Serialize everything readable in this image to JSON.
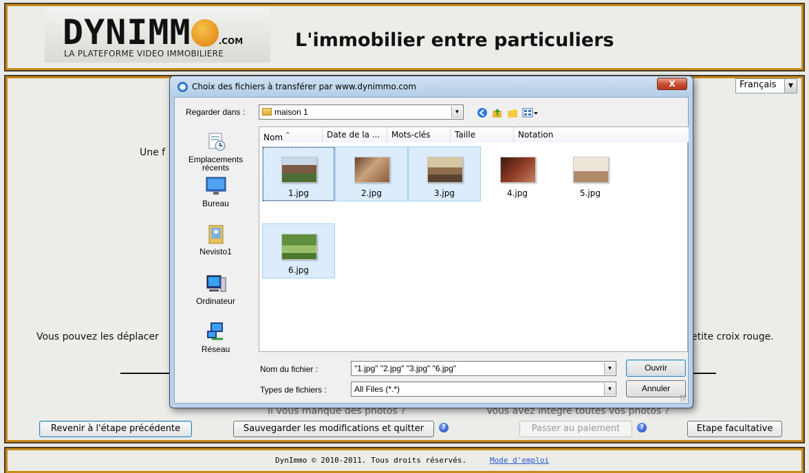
{
  "header": {
    "logo_word_part1": "DYNIMM",
    "logo_com": ".COM",
    "logo_subtitle": "LA PLATEFORME VIDEO IMMOBILIERE",
    "tagline": "L'immobilier entre particuliers"
  },
  "language": {
    "selected": "Français"
  },
  "main": {
    "partial_text_left": "Une f",
    "hint_left": "Vous pouvez les déplacer",
    "hint_right": "etite croix rouge.",
    "missing_photos": "Il vous manque des photos ?",
    "all_photos": "Vous avez intégré toutes vos photos ?",
    "buttons": {
      "previous": "Revenir à l'étape précédente",
      "save_quit": "Sauvegarder les modifications et quitter",
      "pay": "Passer au paiement",
      "optional": "Etape facultative"
    }
  },
  "footer": {
    "copyright": "DynImmo © 2010-2011. Tous droits réservés.",
    "manual_link": "Mode d'emploi"
  },
  "dialog": {
    "title": "Choix des fichiers à transférer par www.dynimmo.com",
    "close": "X",
    "look_in_label": "Regarder dans :",
    "look_in_value": "maison 1",
    "places": [
      {
        "label": "Emplacements récents",
        "icon": "recent-places-icon"
      },
      {
        "label": "Bureau",
        "icon": "desktop-icon"
      },
      {
        "label": "Nevisto1",
        "icon": "user-folder-icon"
      },
      {
        "label": "Ordinateur",
        "icon": "computer-icon"
      },
      {
        "label": "Réseau",
        "icon": "network-icon"
      }
    ],
    "columns": [
      "Nom",
      "Date de la ...",
      "Mots-clés",
      "Taille",
      "Notation"
    ],
    "files": [
      {
        "name": "1.jpg",
        "selected": true
      },
      {
        "name": "2.jpg",
        "selected": true
      },
      {
        "name": "3.jpg",
        "selected": true
      },
      {
        "name": "4.jpg",
        "selected": false
      },
      {
        "name": "5.jpg",
        "selected": false
      },
      {
        "name": "6.jpg",
        "selected": true
      }
    ],
    "filename_label": "Nom du fichier :",
    "filename_value": "\"1.jpg\" \"2.jpg\" \"3.jpg\" \"6.jpg\"",
    "filetype_label": "Types de fichiers :",
    "filetype_value": "All Files (*.*)",
    "open_button": "Ouvrir",
    "cancel_button": "Annuler"
  },
  "colors": {
    "accent_border": "#c98a1a",
    "selection": "#dcecfc",
    "link": "#2255cc"
  }
}
